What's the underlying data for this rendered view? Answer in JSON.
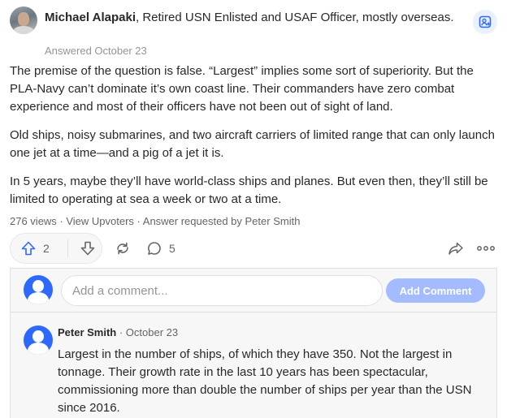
{
  "answer": {
    "author_name": "Michael Alapaki",
    "author_credential": ", Retired USN Enlisted and USAF Officer, mostly overseas.",
    "answered_date": "Answered October 23",
    "paragraphs": [
      "The premise of the question is false. “Largest” implies some sort of superiority. But the PLA-Navy can’t dominate it’s own coast line. Their commanders have zero combat experience and most of their officers have not been out of sight of land.",
      "Old ships, noisy submarines, and two aircraft carriers of limited range that can only launch one jet at a time—and a pig of a jet it is.",
      "In 5 years, maybe they’ll have world-class ships and planes. But even then, they’ll still be limited to operating at sea a week or two at a time."
    ],
    "meta": "276 views · View Upvoters · Answer requested by Peter Smith",
    "upvotes": "2",
    "comment_count": "5"
  },
  "comment_form": {
    "placeholder": "Add a comment...",
    "button_label": "Add Comment"
  },
  "comments": [
    {
      "author": "Peter Smith",
      "date": " · October 23",
      "text": "Largest in the number of ships, of which they have 350. Not the largest in tonnage. Their growth rate in the last 10 years has been spectacular, commissioning more than double the number of ships per year than the USN since 2016."
    }
  ],
  "colors": {
    "accent": "#2e69ff",
    "button_disabled": "#a4bcff",
    "text": "#282829",
    "muted": "#636466"
  },
  "icons": [
    "follow-icon",
    "upvote-arrow-icon",
    "downvote-arrow-icon",
    "reshare-icon",
    "comment-bubble-icon",
    "share-arrow-icon",
    "more-dots-icon",
    "default-avatar-icon"
  ]
}
